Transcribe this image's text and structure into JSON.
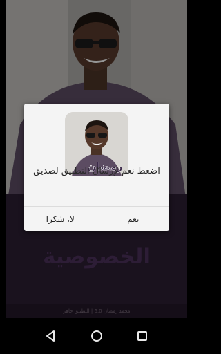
{
  "background": {
    "page_title": "الخصوصية",
    "footer_text": "محمد رمضان 6.0 | التطبيق جاهز"
  },
  "dialog": {
    "icon_caption": "رمضان",
    "message": "اضغط نعم لإرسال التطبيق لصديق",
    "yes_label": "نعم",
    "no_label": "لا، شكرا"
  },
  "navbar": {
    "back": "back-icon",
    "home": "home-icon",
    "recents": "recents-icon"
  },
  "colors": {
    "dialog_bg": "#f4f4f4",
    "privacy_title": "#4a2f58",
    "screen_bottom": "#2a1d31"
  }
}
